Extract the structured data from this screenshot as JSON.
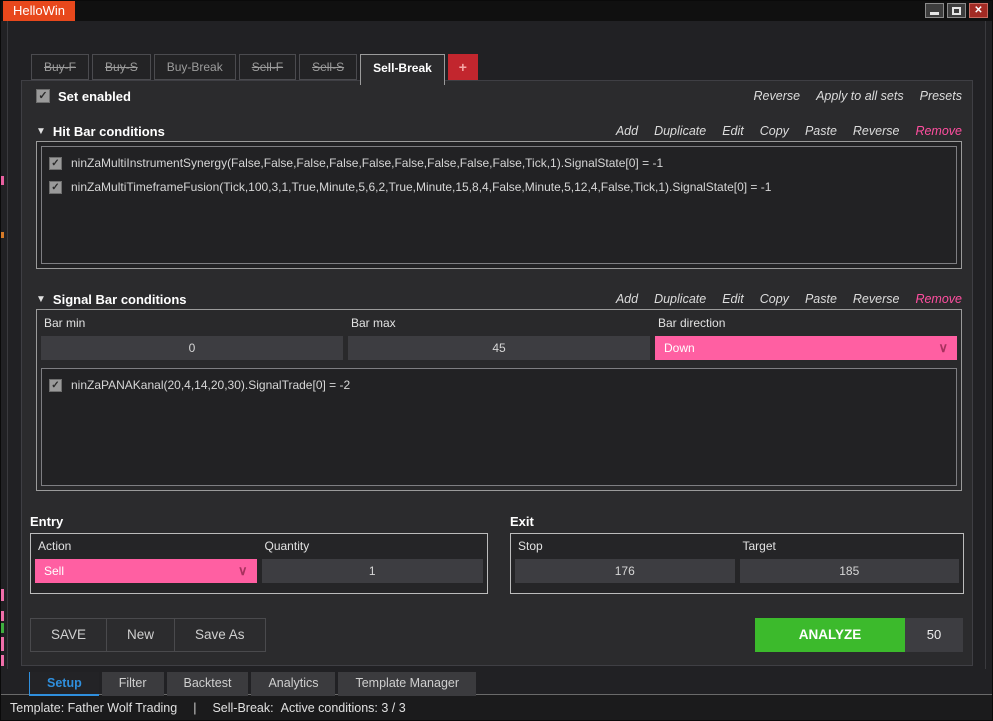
{
  "window": {
    "title": "HelloWin"
  },
  "icons": {
    "check": "✓",
    "close": "✕",
    "dropdown_chevron": "∨",
    "collapse_triangle": "▼"
  },
  "strategy_tabs": {
    "items": [
      {
        "label": "Buy-F"
      },
      {
        "label": "Buy-S"
      },
      {
        "label": "Buy-Break"
      },
      {
        "label": "Sell-F"
      },
      {
        "label": "Sell-S"
      },
      {
        "label": "Sell-Break"
      }
    ],
    "add_label": "+"
  },
  "set_header": {
    "enabled_label": "Set enabled",
    "links": [
      "Reverse",
      "Apply to all sets",
      "Presets"
    ]
  },
  "hit_bar": {
    "title": "Hit Bar conditions",
    "links": [
      "Add",
      "Duplicate",
      "Edit",
      "Copy",
      "Paste",
      "Reverse",
      "Remove"
    ],
    "conditions": [
      "ninZaMultiInstrumentSynergy(False,False,False,False,False,False,False,False,False,Tick,1).SignalState[0] = -1",
      "ninZaMultiTimeframeFusion(Tick,100,3,1,True,Minute,5,6,2,True,Minute,15,8,4,False,Minute,5,12,4,False,Tick,1).SignalState[0] = -1"
    ]
  },
  "signal_bar": {
    "title": "Signal Bar conditions",
    "links": [
      "Add",
      "Duplicate",
      "Edit",
      "Copy",
      "Paste",
      "Reverse",
      "Remove"
    ],
    "bar_min": {
      "label": "Bar min",
      "value": "0"
    },
    "bar_max": {
      "label": "Bar max",
      "value": "45"
    },
    "bar_direction": {
      "label": "Bar direction",
      "value": "Down"
    },
    "conditions": [
      "ninZaPANAKanal(20,4,14,20,30).SignalTrade[0] = -2"
    ]
  },
  "entry": {
    "title": "Entry",
    "action_label": "Action",
    "action_value": "Sell",
    "quantity_label": "Quantity",
    "quantity_value": "1"
  },
  "exit": {
    "title": "Exit",
    "stop_label": "Stop",
    "stop_value": "176",
    "target_label": "Target",
    "target_value": "185"
  },
  "footer_actions": {
    "save": "SAVE",
    "new": "New",
    "save_as": "Save As",
    "analyze": "ANALYZE",
    "analyze_count": "50"
  },
  "bottom_tabs": [
    {
      "label": "Setup"
    },
    {
      "label": "Filter"
    },
    {
      "label": "Backtest"
    },
    {
      "label": "Analytics"
    },
    {
      "label": "Template Manager"
    }
  ],
  "status_bar": {
    "template": "Template: Father Wolf Trading",
    "separator": "|",
    "set_label": "Sell-Break:",
    "info": "Active conditions: 3 / 3"
  },
  "colors": {
    "accent_pink": "#ff5fa2",
    "remove_pink": "#ff4fa0",
    "accent_green": "#3cba2c",
    "accent_blue": "#2f8fdd",
    "title_orange": "#e8481c",
    "add_red": "#c2262e"
  }
}
